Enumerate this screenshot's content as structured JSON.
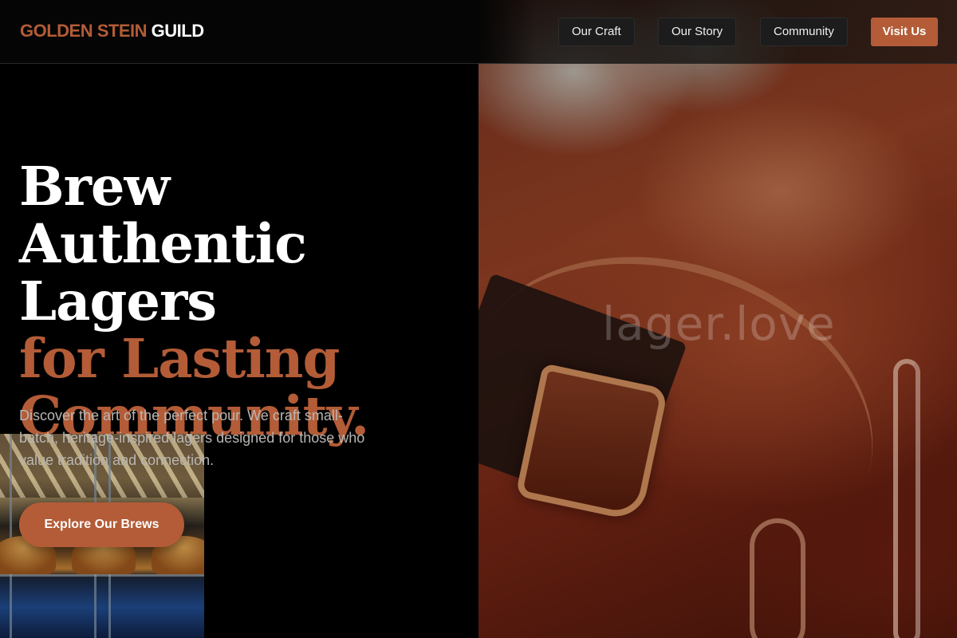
{
  "brand": {
    "part1": "GOLDEN STEIN",
    "part2": "GUILD"
  },
  "nav": {
    "items": [
      {
        "label": "Our Craft"
      },
      {
        "label": "Our Story"
      },
      {
        "label": "Community"
      }
    ],
    "cta_label": "Visit Us"
  },
  "hero": {
    "headline_line1": "Brew Authentic",
    "headline_line2": "Lagers",
    "headline_line3": "for Lasting",
    "headline_line4": "Community.",
    "subtext": "Discover the art of the perfect pour. We craft small-batch, heritage-inspired lagers designed for those who value tradition and connection.",
    "cta_label": "Explore Our Brews",
    "photo_watermark": "lager.love"
  },
  "colors": {
    "accent": "#b35c37",
    "background": "#000000",
    "text_primary": "#ffffff",
    "text_muted": "#b9b6b2"
  }
}
